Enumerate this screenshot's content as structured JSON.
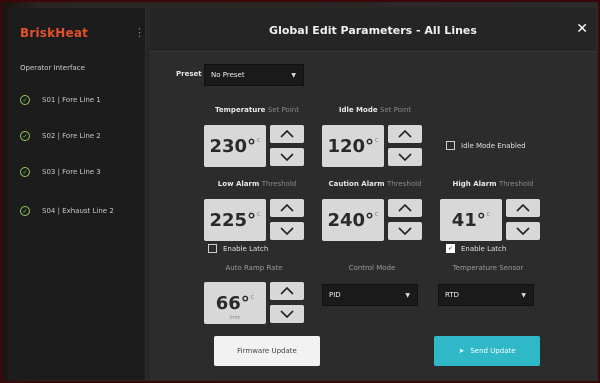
{
  "brand": "BriskHeat",
  "sidebar": {
    "section_title": "Operator Interface",
    "items": [
      {
        "label": "S01 | Fore Line 1"
      },
      {
        "label": "S02 | Fore Line 2"
      },
      {
        "label": "S03 | Fore Line 3"
      },
      {
        "label": "S04 | Exhaust Line 2"
      }
    ]
  },
  "header": {
    "title": "Global Edit Parameters - All Lines",
    "close": "✕"
  },
  "preset": {
    "label": "Preset",
    "value": "No Preset"
  },
  "temperature_set_point": {
    "label": "Temperature",
    "sub": "Set Point",
    "value": "230°",
    "unit": "C"
  },
  "idle_mode_set_point": {
    "label": "Idle Mode",
    "sub": "Set Point",
    "value": "120°",
    "unit": "C"
  },
  "idle_mode_enabled": {
    "label": "Idle Mode Enabled",
    "checked": false
  },
  "low_alarm": {
    "label": "Low Alarm",
    "sub": "Threshold",
    "value": "225°",
    "unit": "C"
  },
  "caution_alarm": {
    "label": "Caution Alarm",
    "sub": "Threshold",
    "value": "240°",
    "unit": "C"
  },
  "high_alarm": {
    "label": "High Alarm",
    "sub": "Threshold",
    "value": "41°",
    "unit": "C"
  },
  "enable_latch_low": {
    "label": "Enable Latch",
    "checked": false
  },
  "enable_latch_high": {
    "label": "Enable Latch",
    "checked": true
  },
  "auto_ramp_rate": {
    "label": "Auto Ramp Rate",
    "value": "66°",
    "unit": "C",
    "caption": "/min"
  },
  "control_mode": {
    "label": "Control Mode",
    "value": "PID"
  },
  "temperature_sensor": {
    "label": "Temperature Sensor",
    "value": "RTD"
  },
  "buttons": {
    "firmware_update": "Firmware Update",
    "send_update": "Send Update"
  },
  "colors": {
    "brand": "#e2512a",
    "accent": "#2eb8c8",
    "check": "#8ac85a"
  }
}
